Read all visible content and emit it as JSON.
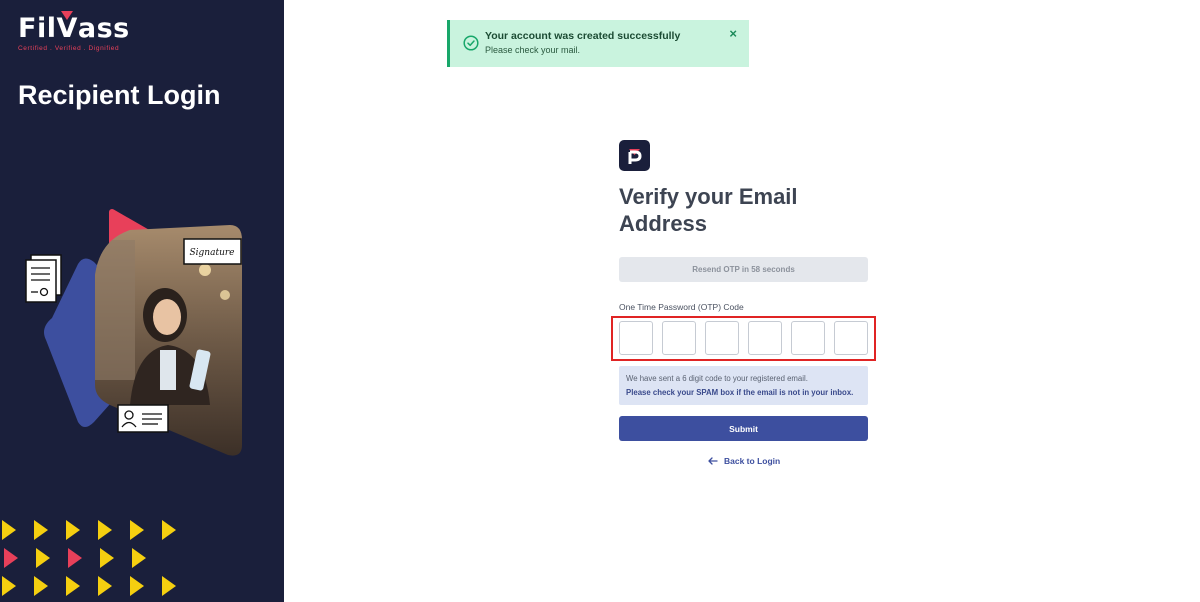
{
  "brand": {
    "logo_text_pre": "Fil",
    "logo_text_v": "V",
    "logo_text_post": "ass",
    "tagline": "Certified . Verified . Dignified",
    "accent_color": "#e8405a",
    "panel_color": "#1a1f3b"
  },
  "left_panel": {
    "title": "Recipient Login",
    "signature_label": "Signature"
  },
  "toast": {
    "title": "Your account was created successfully",
    "message": "Please check your mail.",
    "icon": "check-circle-icon",
    "close_icon": "close-icon",
    "close_glyph": "×"
  },
  "form": {
    "title": "Verify your Email Address",
    "resend_label": "Resend OTP in 58 seconds",
    "otp_label": "One Time Password (OTP) Code",
    "otp_values": [
      "",
      "",
      "",
      "",
      "",
      ""
    ],
    "info_line1": "We have sent a 6 digit code to your registered email.",
    "info_line2": "Please check your SPAM box if the email is not in your inbox.",
    "submit_label": "Submit",
    "back_label": "Back to Login",
    "back_icon": "arrow-left-icon",
    "primary_color": "#3d4f9f"
  }
}
